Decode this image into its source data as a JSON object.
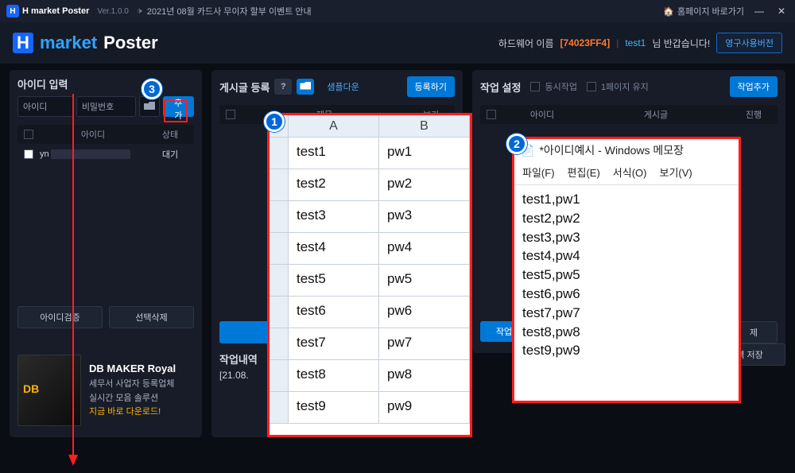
{
  "topbar": {
    "app_name": "H market Poster",
    "version": "Ver.1.0.0",
    "announcement": "2021년 08월 카드사 무이자 할부 이벤트 안내",
    "homepage_link": "홈페이지 바로가기"
  },
  "brand": {
    "word_market": "market",
    "word_poster": "Poster",
    "hw_label": "하드웨어 이름",
    "hw_id": "[74023FF4]",
    "user_name": "test1",
    "greet_suffix": "님 반갑습니다!",
    "license_btn": "영구사용버전"
  },
  "id_panel": {
    "title": "아이디 입력",
    "field_id_label": "아이디",
    "field_pw_label": "비밀번호",
    "add_btn": "추가",
    "th_id": "아이디",
    "th_status": "상태",
    "row0_id_prefix": "yn",
    "row0_status": "대기",
    "btn_verify": "아이디검증",
    "btn_delete": "선택삭제"
  },
  "post_panel": {
    "title": "게시글 등록",
    "sample_dl": "샘플다운",
    "register_btn": "등록하기",
    "th_title": "제목",
    "th_view": "보기"
  },
  "task_panel": {
    "title": "작업 설정",
    "chk_concurrent": "동시작업",
    "chk_keep1page": "1페이지 유지",
    "add_task_btn": "작업추가",
    "th_id": "아이디",
    "th_post": "게시글",
    "th_progress": "진행",
    "run_btn_prefix": "작업",
    "del_btn_suffix": "제"
  },
  "log_panel": {
    "title": "작업내역",
    "line0_prefix": "[21.08.",
    "save_btn_suffix": "내역 저장"
  },
  "promo": {
    "title": "DB MAKER Royal",
    "line1": "세무서 사업자 등록업체",
    "line2": "실시간 모음 솔루션",
    "cta": "지금 바로 다운로드!"
  },
  "excel_overlay": {
    "colA_label": "A",
    "colB_label": "B",
    "rows": [
      {
        "a": "test1",
        "b": "pw1"
      },
      {
        "a": "test2",
        "b": "pw2"
      },
      {
        "a": "test3",
        "b": "pw3"
      },
      {
        "a": "test4",
        "b": "pw4"
      },
      {
        "a": "test5",
        "b": "pw5"
      },
      {
        "a": "test6",
        "b": "pw6"
      },
      {
        "a": "test7",
        "b": "pw7"
      },
      {
        "a": "test8",
        "b": "pw8"
      },
      {
        "a": "test9",
        "b": "pw9"
      }
    ]
  },
  "notepad_overlay": {
    "window_title": "*아이디예시 - Windows 메모장",
    "menu_file": "파일(F)",
    "menu_edit": "편집(E)",
    "menu_format": "서식(O)",
    "menu_view": "보기(V)",
    "lines": [
      "test1,pw1",
      "test2,pw2",
      "test3,pw3",
      "test4,pw4",
      "test5,pw5",
      "test6,pw6",
      "test7,pw7",
      "test8,pw8",
      "test9,pw9"
    ]
  },
  "annotations": {
    "tag1": "1",
    "tag2": "2",
    "tag3": "3"
  }
}
